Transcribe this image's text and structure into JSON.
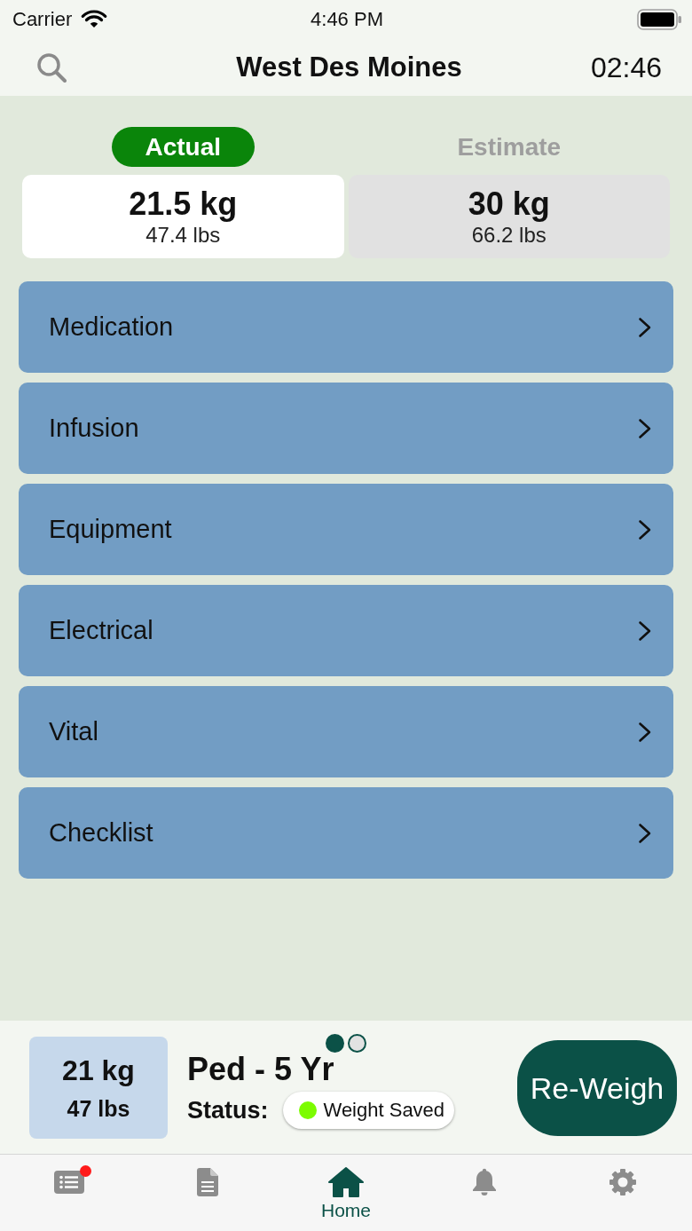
{
  "status_bar": {
    "carrier": "Carrier",
    "time": "4:46 PM"
  },
  "nav_bar": {
    "title": "West Des Moines",
    "timer": "02:46"
  },
  "weight_options": [
    {
      "label": "Actual",
      "kg": "21.5 kg",
      "lbs": "47.4 lbs",
      "selected": true
    },
    {
      "label": "Estimate",
      "kg": "30 kg",
      "lbs": "66.2 lbs",
      "selected": false
    }
  ],
  "menu": [
    "Medication",
    "Infusion",
    "Equipment",
    "Electrical",
    "Vital",
    "Checklist"
  ],
  "summary": {
    "kg": "21 kg",
    "lbs": "47 lbs",
    "pages": [
      {
        "selected": true
      },
      {
        "selected": false
      }
    ],
    "patient": "Ped - 5 Yr",
    "status_label": "Status:",
    "status": {
      "text": "Weight Saved",
      "color": "#7cfc00"
    },
    "button": "Re-Weigh"
  },
  "tab_bar": [
    {
      "kind": "list",
      "badge": true,
      "selected": false
    },
    {
      "kind": "document",
      "badge": false,
      "selected": false
    },
    {
      "kind": "home",
      "label": "Home",
      "badge": false,
      "selected": true
    },
    {
      "kind": "bell",
      "badge": false,
      "selected": false
    },
    {
      "kind": "gear",
      "badge": false,
      "selected": false
    }
  ]
}
